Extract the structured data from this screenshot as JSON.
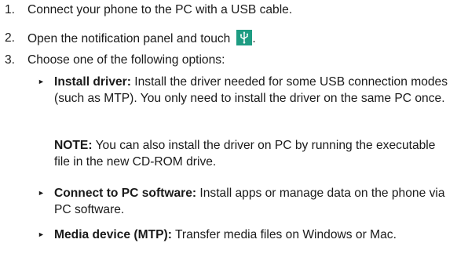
{
  "steps": [
    {
      "number": "1.",
      "text": "Connect your phone to the PC with a USB cable."
    },
    {
      "number": "2.",
      "text": "Open the notification panel and touch",
      "icon": "usb-icon",
      "icon_color": "#1e9c82",
      "suffix": "."
    },
    {
      "number": "3.",
      "text": "Choose one of the following options:"
    }
  ],
  "options": [
    {
      "marker": "►",
      "label": "Install driver:",
      "text": "Install the driver needed for some USB connection modes (such as MTP). You only need to install the driver on the same PC once."
    },
    {
      "marker": "►",
      "label": "Connect to PC software:",
      "text": "Install apps or manage data on the phone via PC software."
    },
    {
      "marker": "►",
      "label": "Media device (MTP):",
      "text": "Transfer media files on Windows or Mac."
    }
  ],
  "note": {
    "label": "NOTE:",
    "text": "You can also install the driver on PC by running the executable file in the new CD-ROM drive."
  }
}
